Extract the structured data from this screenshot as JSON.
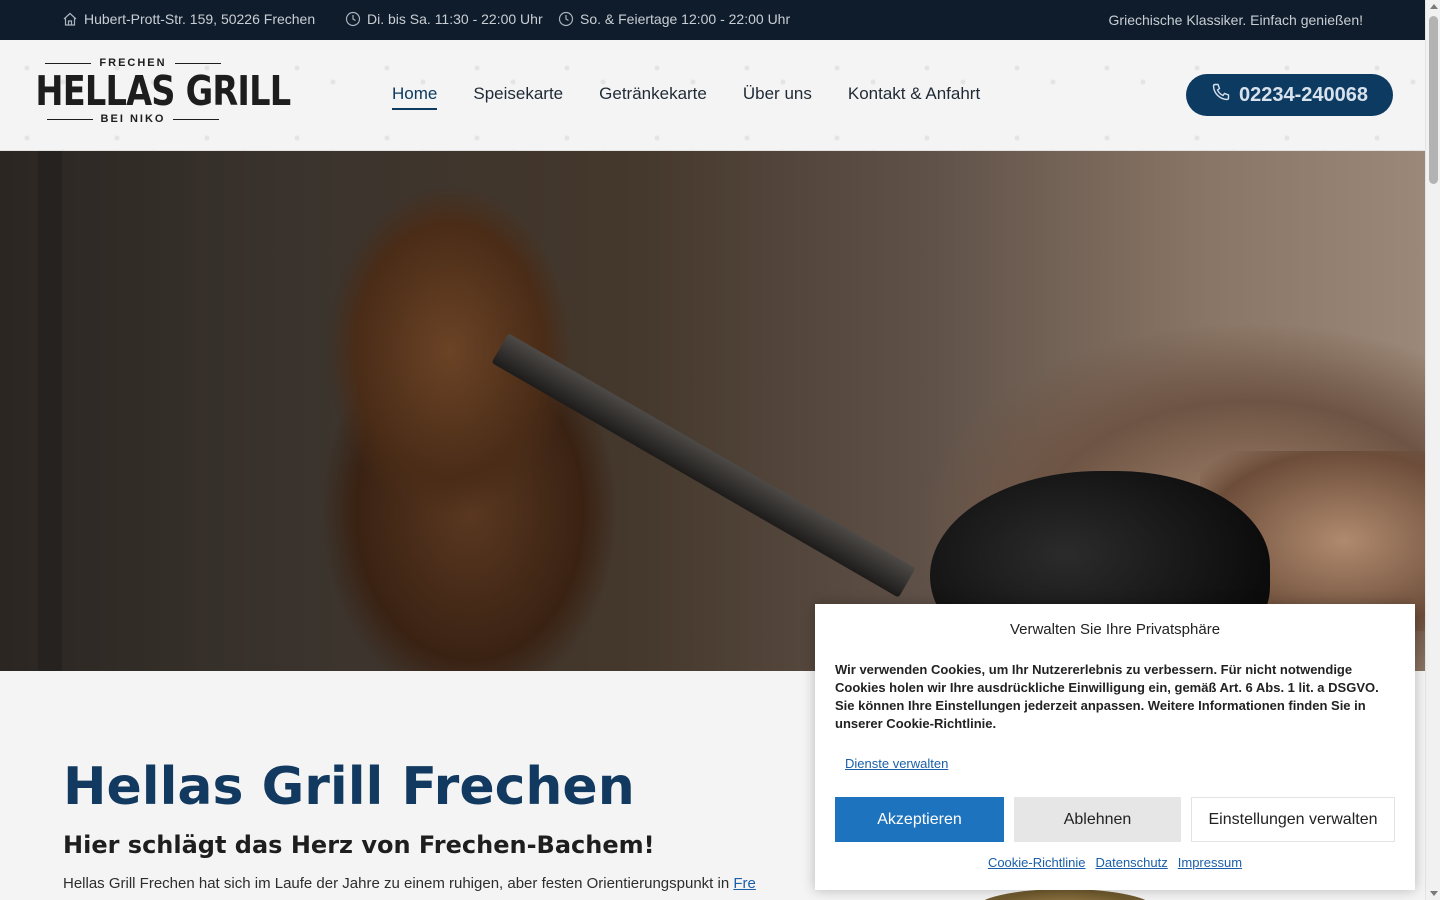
{
  "topbar": {
    "address": "Hubert-Prott-Str. 159, 50226 Frechen",
    "hours_weekdays": "Di. bis Sa. 11:30 - 22:00 Uhr",
    "hours_holidays": "So. & Feiertage 12:00 - 22:00 Uhr",
    "tagline": "Griechische Klassiker. Einfach genießen!"
  },
  "logo": {
    "top": "FRECHEN",
    "main": "HELLAS GRILL",
    "bottom": "BEI NIKO"
  },
  "nav": {
    "items": [
      {
        "label": "Home",
        "active": true
      },
      {
        "label": "Speisekarte",
        "active": false
      },
      {
        "label": "Getränkekarte",
        "active": false
      },
      {
        "label": "Über uns",
        "active": false
      },
      {
        "label": "Kontakt & Anfahrt",
        "active": false
      }
    ]
  },
  "phone": {
    "number": "02234-240068",
    "icon": "phone-icon"
  },
  "content": {
    "title": "Hellas Grill Frechen",
    "subtitle": "Hier schlägt das Herz von Frechen-Bachem!",
    "paragraph_start": "Hellas Grill Frechen hat sich im Laufe der Jahre zu einem ruhigen, aber festen Orientierungspunkt in ",
    "paragraph_link": "Fre"
  },
  "cookie": {
    "title": "Verwalten Sie Ihre Privatsphäre",
    "text": "Wir verwenden Cookies, um Ihr Nutzererlebnis zu verbessern. Für nicht notwendige Cookies holen wir Ihre ausdrückliche Einwilligung ein, gemäß Art. 6 Abs. 1 lit. a DSGVO. Sie können Ihre Einstellungen jederzeit anpassen. Weitere Informationen finden Sie in unserer Cookie-Richtlinie.",
    "manage_services": "Dienste verwalten",
    "accept": "Akzeptieren",
    "deny": "Ablehnen",
    "preferences": "Einstellungen verwalten",
    "links": [
      "Cookie-Richtlinie",
      "Datenschutz",
      "Impressum"
    ]
  },
  "colors": {
    "topbar_bg": "#0e1c2c",
    "brand_blue": "#0d3a61",
    "accept_blue": "#1e73be",
    "link_blue": "#1a5fa8"
  }
}
